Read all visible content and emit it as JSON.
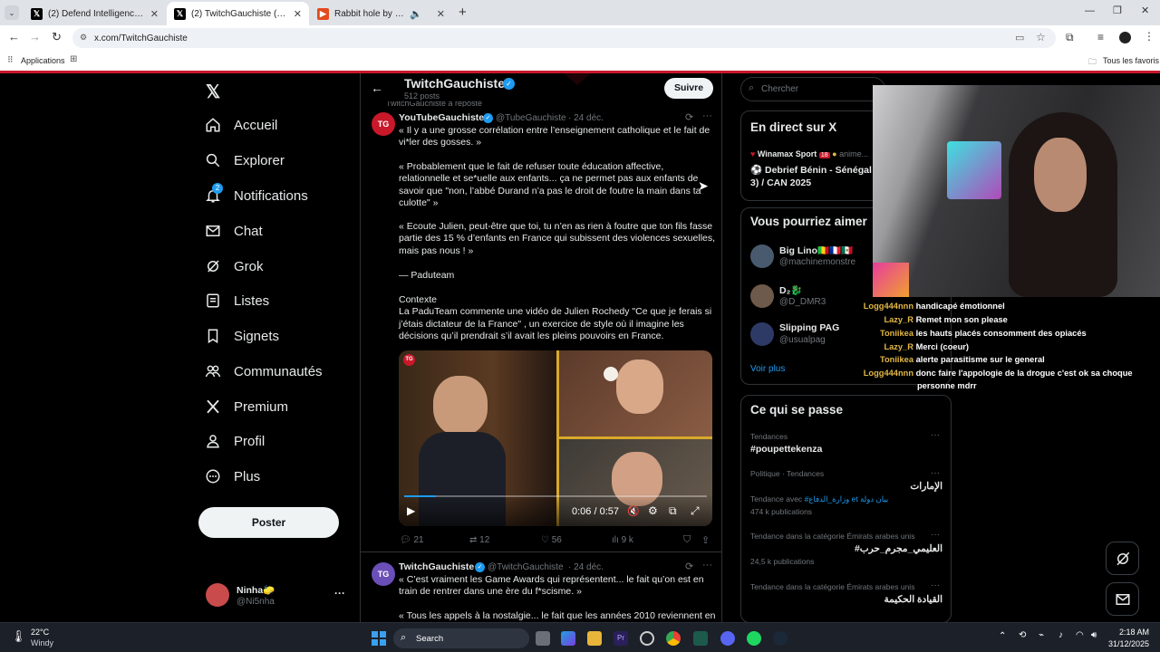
{
  "browser": {
    "tabs": [
      {
        "title": "(2) Defend Intelligence (Anis Ay",
        "active": false
      },
      {
        "title": "(2) TwitchGauchiste (@TwitchGa",
        "active": true
      },
      {
        "title": "Rabbit hole by Lazy R",
        "active": false
      }
    ],
    "url": "x.com/TwitchGauchiste",
    "bookmarks": {
      "apps": "Applications",
      "all": "Tous les favoris"
    }
  },
  "sidebar": {
    "items": [
      {
        "label": "Accueil",
        "icon": "home-icon"
      },
      {
        "label": "Explorer",
        "icon": "search-icon"
      },
      {
        "label": "Notifications",
        "icon": "bell-icon",
        "badge": "2"
      },
      {
        "label": "Chat",
        "icon": "mail-icon"
      },
      {
        "label": "Grok",
        "icon": "grok-icon"
      },
      {
        "label": "Listes",
        "icon": "list-icon"
      },
      {
        "label": "Signets",
        "icon": "bookmark-icon"
      },
      {
        "label": "Communautés",
        "icon": "people-icon"
      },
      {
        "label": "Premium",
        "icon": "x-icon"
      },
      {
        "label": "Profil",
        "icon": "person-icon"
      },
      {
        "label": "Plus",
        "icon": "more-icon"
      }
    ],
    "post_button": "Poster",
    "account": {
      "name": "Ninha🧽",
      "handle": "@Ni5nha"
    }
  },
  "profile_header": {
    "name": "TwitchGauchiste",
    "posts": "512 posts",
    "follow": "Suivre"
  },
  "tweet1": {
    "repost_line": "TwitchGauchiste a reposté",
    "avatar_text": "TG",
    "name": "YouTubeGauchiste",
    "handle": "@TubeGauchiste",
    "date": "· 24 déc.",
    "p1": "« Il y a une grosse corrélation entre l’enseignement catholique et le fait de\nvi*ler des gosses. »",
    "p2": "« Probablement que le fait de refuser toute éducation affective,\nrelationnelle et se*uelle aux enfants... ça ne permet pas aux enfants de\nsavoir que \"non, l’abbé Durand n’a pas le droit de foutre la main dans ta\nculotte\" »",
    "p3": "« Ecoute Julien, peut-être que toi, tu n’en as rien à foutre que ton fils fasse\npartie des 15 % d’enfants en France qui subissent des violences sexuelles,\nmais pas nous ! »",
    "p4": "— Paduteam",
    "p5": "Contexte\nLa PaduTeam commente une vidéo de Julien Rochedy \"Ce que je ferais si\nj’étais dictateur de la France\" , un exercice de style où il imagine les\ndécisions qu’il prendrait s’il avait les pleins pouvoirs en France.",
    "video_time": "0:06 / 0:57",
    "video_progress": 0.105,
    "stats": {
      "replies": "21",
      "reposts": "12",
      "likes": "56",
      "views": "9 k"
    }
  },
  "tweet2": {
    "avatar_text": "TG",
    "name": "TwitchGauchiste",
    "handle": "@TwitchGauchiste",
    "date": "· 24 déc.",
    "p1": "« C’est vraiment les Game Awards qui représentent... le fait qu’on est en\ntrain de rentrer dans une ère du f*scisme. »",
    "p2": "« Tous les appels à la nostalgie... le fait que les années 2010 reviennent en"
  },
  "right": {
    "search_placeholder": "Chercher",
    "live": {
      "title": "En direct sur X",
      "host": "Winamax Sport",
      "host_badge": "18",
      "host_note": "anime...",
      "event": "Debrief Bénin - Sénégal (",
      "event2": "3) / CAN 2025"
    },
    "suggest": {
      "title": "Vous pourriez aimer",
      "accounts": [
        {
          "name": "Big Lino🇲🇱🇫🇷🇲🇽",
          "handle": "@machinemonstre"
        },
        {
          "name": "D₂🐉",
          "handle": "@D_DMR3"
        },
        {
          "name": "Slipping PAG",
          "handle": "@usualpag"
        }
      ],
      "more": "Voir plus"
    },
    "trends": {
      "title": "Ce qui se passe",
      "items": [
        {
          "meta": "Tendances",
          "name": "#poupettekenza"
        },
        {
          "meta": "Politique · Tendances",
          "name": "الإمارات",
          "extra": "Tendance avec",
          "tags": "#وزارة_الدفاع et بيان دولة",
          "count": "474 k publications"
        },
        {
          "meta": "Tendance dans la catégorie Émirats arabes unis",
          "name": "#العليمي_مجرم_حرب",
          "count": "24,5 k publications"
        },
        {
          "meta": "Tendance dans la catégorie Émirats arabes unis",
          "name": "القيادة الحكيمة"
        }
      ]
    }
  },
  "stream_chat": [
    {
      "user": "",
      "msg": "handicapé émotionnel"
    },
    {
      "user": "Lazy_R",
      "msg": "Remet mon son please"
    },
    {
      "user": "Toniikea",
      "msg": "les hauts placés consomment des opiacés"
    },
    {
      "user": "Lazy_R",
      "msg": "Merci (coeur)"
    },
    {
      "user": "Toniikea",
      "msg": "alerte parasitisme sur le general"
    },
    {
      "user": "Logg444nnn",
      "msg": "donc faire l'appologie de la drogue c'est ok sa choque"
    },
    {
      "user": "",
      "msg": "personne mdrr"
    }
  ],
  "stream_chat_first_user": "Logg444nnn",
  "taskbar": {
    "weather_temp": "22°C",
    "weather_desc": "Windy",
    "search": "Search",
    "time": "2:18 AM",
    "date": "31/12/2025"
  },
  "colors": {
    "accent": "#1d9bf0",
    "verified": "#1d9bf0",
    "chat_user": "#e5b845",
    "brand_red": "#c9182a"
  }
}
